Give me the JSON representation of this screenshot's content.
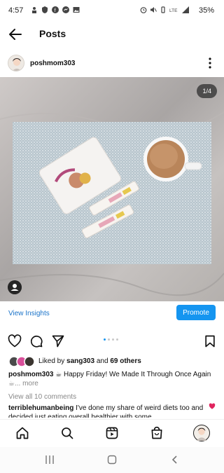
{
  "status_bar": {
    "time": "4:57",
    "battery": "35%",
    "icons": [
      "person-icon",
      "shield-icon",
      "facebook-icon",
      "messenger-icon",
      "image-icon",
      "alarm-icon",
      "mute-icon",
      "vibrate-icon",
      "vo-lte-icon",
      "signal-icon"
    ]
  },
  "header": {
    "title": "Posts",
    "back_icon": "arrow-left-icon"
  },
  "post": {
    "username": "poshmom303",
    "image_counter": "1/4",
    "view_insights_label": "View Insights",
    "promote_label": "Promote",
    "carousel": {
      "total": 4,
      "active": 1
    },
    "liked_by_prefix": "Liked by",
    "liked_by_user": "sang303",
    "liked_by_suffix": "and",
    "liked_by_others": "69 others",
    "caption_username": "poshmom303",
    "caption_text": "☕ Happy Friday!  We Made It Through Once Again",
    "caption_more": "☕... more",
    "view_all_comments": "View all 10 comments",
    "comment_username": "terriblehumanbeing",
    "comment_text": "I've done my share of weird diets too and decided just eating overall healthier with some"
  },
  "colors": {
    "accent": "#1595f0",
    "link": "#1a73c9",
    "heart": "#e0245e"
  }
}
